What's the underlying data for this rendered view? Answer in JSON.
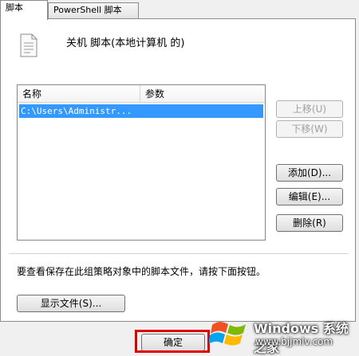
{
  "tabs": [
    {
      "label": "脚本",
      "active": true
    },
    {
      "label": "PowerShell 脚本",
      "active": false
    }
  ],
  "header": {
    "title": "关机 脚本(本地计算机 的)"
  },
  "list": {
    "columns": [
      "名称",
      "参数"
    ],
    "rows": [
      {
        "name": "C:\\Users\\Administr...",
        "selected": true
      }
    ]
  },
  "buttons": {
    "move_up": "上移(U)",
    "move_down": "下移(W)",
    "add": "添加(D)...",
    "edit": "编辑(E)...",
    "delete": "删除(R)",
    "show_files": "显示文件(S)...",
    "ok": "确定"
  },
  "info_text": "要查看保存在此组策略对象中的脚本文件，请按下面按钮。",
  "watermark": {
    "title": "Windows 系统之家",
    "url": "www.bjjmlv.com"
  },
  "colors": {
    "selection": "#3399ff",
    "highlight_box": "#e00000"
  }
}
